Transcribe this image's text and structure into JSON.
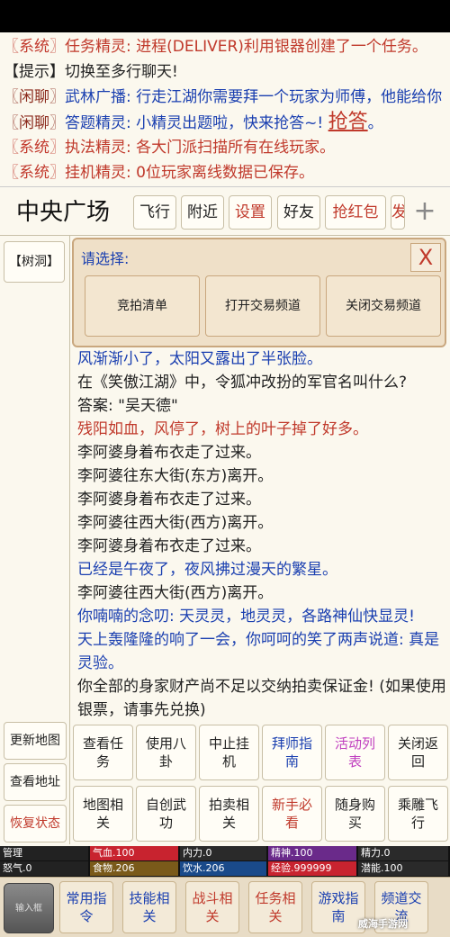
{
  "chat": [
    {
      "channel": "〖系统〗",
      "name": "任务精灵: ",
      "text": "进程(DELIVER)利用银器创建了一个任务。",
      "cls": "msg-red"
    },
    {
      "channel": "【提示】",
      "name": "",
      "text": "切换至多行聊天!",
      "cls": "msg-dark"
    },
    {
      "channel": "〖闲聊〗",
      "name": "武林广播: ",
      "text": "行走江湖你需要拜一个玩家为师傅，他能给你",
      "cls": "msg-blue"
    },
    {
      "channel": "〖闲聊〗",
      "name": "答题精灵: ",
      "text": "小精灵出题啦，快来抢答~! ",
      "cls": "msg-blue",
      "link": "抢答",
      "after": "。"
    },
    {
      "channel": "〖系统〗",
      "name": "执法精灵: ",
      "text": "各大门派扫描所有在线玩家。",
      "cls": "msg-red"
    },
    {
      "channel": "〖系统〗",
      "name": "挂机精灵: ",
      "text": "0位玩家离线数据已保存。",
      "cls": "msg-red"
    }
  ],
  "location": {
    "name": "中央广场"
  },
  "top_buttons": [
    "飞行",
    "附近",
    "设置",
    "好友",
    "抢红包",
    "发"
  ],
  "plus_icon": "+",
  "tree_button": "【树洞】",
  "side_buttons": [
    "更新地图",
    "查看地址",
    "恢复状态"
  ],
  "popup": {
    "title": "请选择:",
    "close": "X",
    "options": [
      "竞拍清单",
      "打开交易频道",
      "关闭交易频道"
    ]
  },
  "log": [
    {
      "text": "风渐渐小了，太阳又露出了半张脸。",
      "cls": "msg-blue"
    },
    {
      "text": "在《笑傲江湖》中，令狐冲改扮的军官名叫什么?",
      "cls": "msg-dark"
    },
    {
      "text": "答案: \"吴天德\"",
      "cls": "msg-dark"
    },
    {
      "text": "残阳如血，风停了，树上的叶子掉了好多。",
      "cls": "msg-red"
    },
    {
      "text": "李阿婆身着布衣走了过来。",
      "cls": "msg-dark"
    },
    {
      "text": "李阿婆往东大街(东方)离开。",
      "cls": "msg-dark"
    },
    {
      "text": "李阿婆身着布衣走了过来。",
      "cls": "msg-dark"
    },
    {
      "text": "李阿婆往西大街(西方)离开。",
      "cls": "msg-dark"
    },
    {
      "text": "李阿婆身着布衣走了过来。",
      "cls": "msg-dark"
    },
    {
      "text": "已经是午夜了，夜风拂过漫天的繁星。",
      "cls": "msg-blue"
    },
    {
      "text": "李阿婆往西大街(西方)离开。",
      "cls": "msg-dark"
    },
    {
      "text": "你喃喃的念叨: 天灵灵，地灵灵，各路神仙快显灵!",
      "cls": "msg-blue"
    },
    {
      "text": "天上轰隆隆的响了一会，你呵呵的笑了两声说道: 真是灵验。",
      "cls": "msg-blue"
    },
    {
      "text": "你全部的身家财产尚不足以交纳拍卖保证金! (如果使用银票，请事先兑换)",
      "cls": "msg-dark"
    }
  ],
  "grid": [
    {
      "label": "查看任务",
      "cls": ""
    },
    {
      "label": "使用八卦",
      "cls": ""
    },
    {
      "label": "中止挂机",
      "cls": ""
    },
    {
      "label": "拜师指南",
      "cls": "blue"
    },
    {
      "label": "活动列表",
      "cls": "pink"
    },
    {
      "label": "关闭返回",
      "cls": ""
    },
    {
      "label": "地图相关",
      "cls": ""
    },
    {
      "label": "自创武功",
      "cls": ""
    },
    {
      "label": "拍卖相关",
      "cls": ""
    },
    {
      "label": "新手必看",
      "cls": "red"
    },
    {
      "label": "随身购买",
      "cls": ""
    },
    {
      "label": "乘雕飞行",
      "cls": ""
    }
  ],
  "stats": [
    {
      "label": "管理",
      "color": "#222222"
    },
    {
      "label": "气血.100",
      "color": "#c8232f"
    },
    {
      "label": "内力.0",
      "color": "#2a2a2a"
    },
    {
      "label": "精神.100",
      "color": "#6a2a8a"
    },
    {
      "label": "精力.0",
      "color": "#2a2a2a"
    },
    {
      "label": "怒气.0",
      "color": "#222222"
    },
    {
      "label": "食物.206",
      "color": "#7a5a1a"
    },
    {
      "label": "饮水.206",
      "color": "#1a4a8a"
    },
    {
      "label": "经验.999999",
      "color": "#c8232f"
    },
    {
      "label": "潜能.100",
      "color": "#2a2a2a"
    }
  ],
  "input_button": "输入框",
  "nav": [
    {
      "label": "常用指令",
      "cls": ""
    },
    {
      "label": "技能相关",
      "cls": ""
    },
    {
      "label": "战斗相关",
      "cls": "red"
    },
    {
      "label": "任务相关",
      "cls": "red"
    },
    {
      "label": "游戏指南",
      "cls": ""
    },
    {
      "label": "频道交流",
      "cls": ""
    }
  ],
  "watermark": "威海手游网"
}
